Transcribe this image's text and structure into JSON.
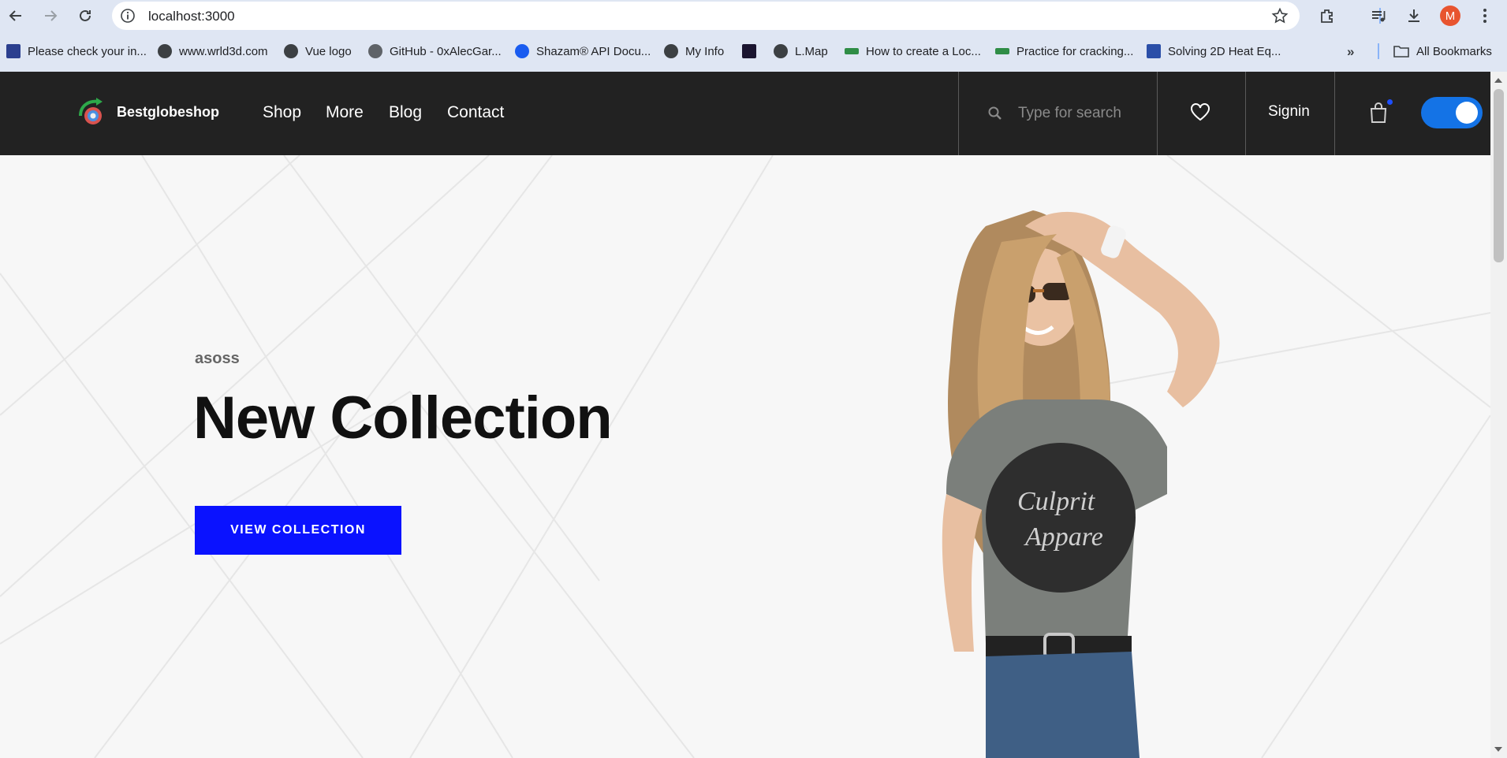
{
  "browser": {
    "url": "localhost:3000",
    "avatar_initial": "M",
    "accent_color": "#1473e6",
    "bookmarks": [
      {
        "label": "Please check your in...",
        "icon": "checkbox-icon"
      },
      {
        "label": "www.wrld3d.com",
        "icon": "globe-icon"
      },
      {
        "label": "Vue logo",
        "icon": "globe-icon"
      },
      {
        "label": "GitHub - 0xAlecGar...",
        "icon": "github-icon"
      },
      {
        "label": "Shazam® API Docu...",
        "icon": "shazam-icon"
      },
      {
        "label": "My Info",
        "icon": "globe-icon"
      },
      {
        "label": "",
        "icon": "ui-icon"
      },
      {
        "label": "L.Map",
        "icon": "globe-icon"
      },
      {
        "label": "How to create a Loc...",
        "icon": "gfg-icon"
      },
      {
        "label": "Practice for cracking...",
        "icon": "gfg-icon"
      },
      {
        "label": "Solving 2D Heat Eq...",
        "icon": "co-icon"
      }
    ],
    "all_bookmarks_label": "All Bookmarks"
  },
  "header": {
    "brand": "Bestglobeshop",
    "menu": [
      "Shop",
      "More",
      "Blog",
      "Contact"
    ],
    "search_placeholder": "Type for search",
    "signin_label": "Signin",
    "toggle_on": true
  },
  "hero": {
    "subtitle": "asoss",
    "title": "New Collection",
    "cta_label": "VIEW COLLECTION",
    "cta_color": "#0a12ff"
  }
}
